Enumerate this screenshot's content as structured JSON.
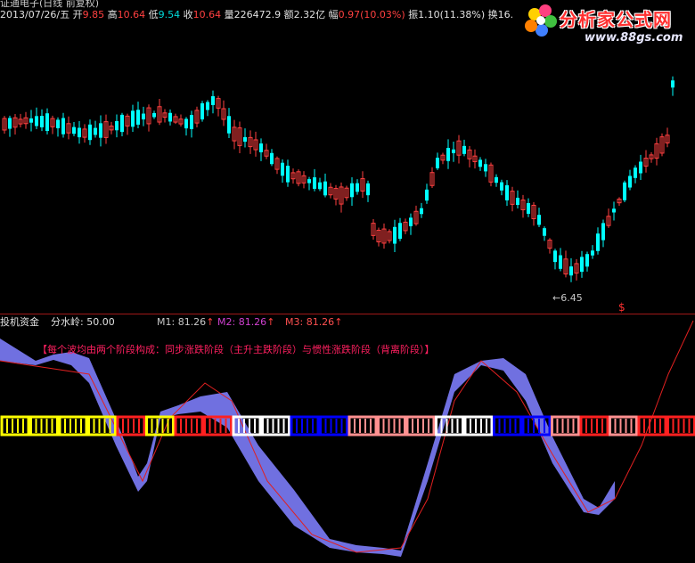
{
  "window": {
    "title": "证通电子(日线 前复权)"
  },
  "quote": {
    "date": "2013/07/26/五",
    "items": [
      {
        "label": "开",
        "value": "9.85",
        "color": "#ff4040"
      },
      {
        "label": "高",
        "value": "10.64",
        "color": "#ff4040"
      },
      {
        "label": "低",
        "value": "9.54",
        "color": "#00d8d8"
      },
      {
        "label": "收",
        "value": "10.64",
        "color": "#ff4040"
      },
      {
        "label": "量",
        "value": "226472.9",
        "color": "#e0e0e0"
      },
      {
        "label": "额",
        "value": "2.32亿",
        "color": "#e0e0e0"
      },
      {
        "label": "幅",
        "value": "0.97(10.03%)",
        "color": "#ff4040"
      },
      {
        "label": "振",
        "value": "1.10(11.38%)",
        "color": "#e0e0e0"
      },
      {
        "label": "换",
        "value": "16.",
        "color": "#e0e0e0"
      }
    ]
  },
  "logo": {
    "brand": "分析家公式网",
    "url": "www.88gs.com"
  },
  "price_chart": {
    "low_marker": "←6.45",
    "signal_marker": "$"
  },
  "indicator": {
    "name": "投机资金",
    "param_label": "分水岭: 50.00",
    "m1": "M1: 81.26",
    "m2": "M2: 81.26",
    "m3": "M3: 81.26",
    "arrow": "↑",
    "annotation": "【每个波均由两个阶段构成：同步涨跌阶段（主升主跌阶段）与惯性涨跌阶段（背离阶段）】"
  },
  "colors": {
    "up": "#ff4040",
    "down": "#00ffff",
    "band": "#7070e0",
    "line": "#e02020",
    "m1": "#c8c8c8",
    "m2": "#d040d0",
    "m3": "#ff5050",
    "annotation": "#ff2060",
    "divider": "#a01818",
    "stripe_palette": [
      "#ffff00",
      "#ff2020",
      "#ff9090",
      "#0000ff",
      "#ffffff"
    ]
  }
}
